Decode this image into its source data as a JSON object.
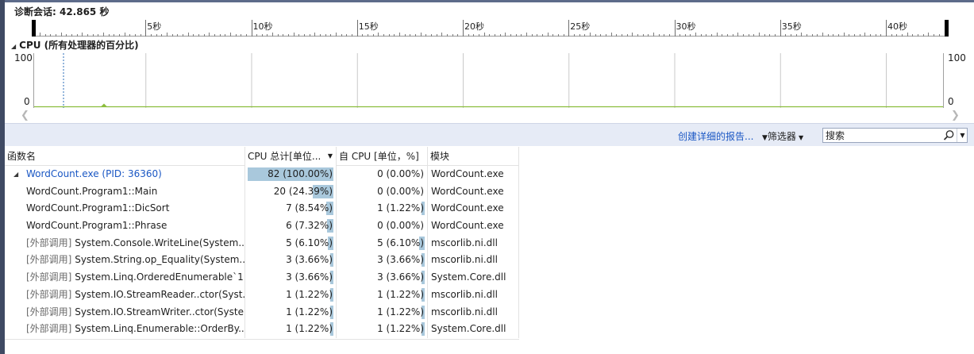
{
  "session": {
    "label": "诊断会话: 42.865 秒"
  },
  "ruler": {
    "ticks": [
      "5秒",
      "10秒",
      "15秒",
      "20秒",
      "25秒",
      "30秒",
      "35秒",
      "40秒"
    ]
  },
  "cpu": {
    "title": "CPU (所有处理器的百分比)",
    "y_max_label": "100",
    "y_min_label": "0"
  },
  "toolbar": {
    "report_link": "创建详细的报告...",
    "filter_label": "筛选器",
    "search_placeholder": "搜索"
  },
  "table": {
    "columns": [
      "函数名",
      "CPU 总计[单位...",
      "自 CPU [单位，%]",
      "模块"
    ],
    "rows": [
      {
        "prefix": "",
        "name": "WordCount.exe (PID: 36360)",
        "total": "82 (100.00%)",
        "total_pct": 100.0,
        "self": "0 (0.00%)",
        "self_pct": 0.0,
        "module": "WordCount.exe",
        "root": true
      },
      {
        "prefix": "",
        "name": "WordCount.Program1::Main",
        "total": "20 (24.39%)",
        "total_pct": 24.39,
        "self": "0 (0.00%)",
        "self_pct": 0.0,
        "module": "WordCount.exe"
      },
      {
        "prefix": "",
        "name": "WordCount.Program1::DicSort",
        "total": "7 (8.54%)",
        "total_pct": 8.54,
        "self": "1 (1.22%)",
        "self_pct": 1.22,
        "module": "WordCount.exe"
      },
      {
        "prefix": "",
        "name": "WordCount.Program1::Phrase",
        "total": "6 (7.32%)",
        "total_pct": 7.32,
        "self": "0 (0.00%)",
        "self_pct": 0.0,
        "module": "WordCount.exe"
      },
      {
        "prefix": "[外部调用]",
        "name": "System.Console.WriteLine(System....",
        "total": "5 (6.10%)",
        "total_pct": 6.1,
        "self": "5 (6.10%)",
        "self_pct": 6.1,
        "module": "mscorlib.ni.dll"
      },
      {
        "prefix": "[外部调用]",
        "name": "System.String.op_Equality(System....",
        "total": "3 (3.66%)",
        "total_pct": 3.66,
        "self": "3 (3.66%)",
        "self_pct": 3.66,
        "module": "mscorlib.ni.dll"
      },
      {
        "prefix": "[外部调用]",
        "name": "System.Linq.OrderedEnumerable`1...",
        "total": "3 (3.66%)",
        "total_pct": 3.66,
        "self": "3 (3.66%)",
        "self_pct": 3.66,
        "module": "System.Core.dll"
      },
      {
        "prefix": "[外部调用]",
        "name": "System.IO.StreamReader..ctor(Syst...",
        "total": "1 (1.22%)",
        "total_pct": 1.22,
        "self": "1 (1.22%)",
        "self_pct": 1.22,
        "module": "mscorlib.ni.dll"
      },
      {
        "prefix": "[外部调用]",
        "name": "System.IO.StreamWriter..ctor(Syste...",
        "total": "1 (1.22%)",
        "total_pct": 1.22,
        "self": "1 (1.22%)",
        "self_pct": 1.22,
        "module": "mscorlib.ni.dll"
      },
      {
        "prefix": "[外部调用]",
        "name": "System.Linq.Enumerable::OrderBy...",
        "total": "1 (1.22%)",
        "total_pct": 1.22,
        "self": "1 (1.22%)",
        "self_pct": 1.22,
        "module": "System.Core.dll"
      }
    ]
  },
  "colors": {
    "accent_link": "#1a57c4",
    "bar_fill": "#a9c8dc",
    "toolbar_bg": "#e6ebf6",
    "cpu_line": "#8bbd3c"
  }
}
